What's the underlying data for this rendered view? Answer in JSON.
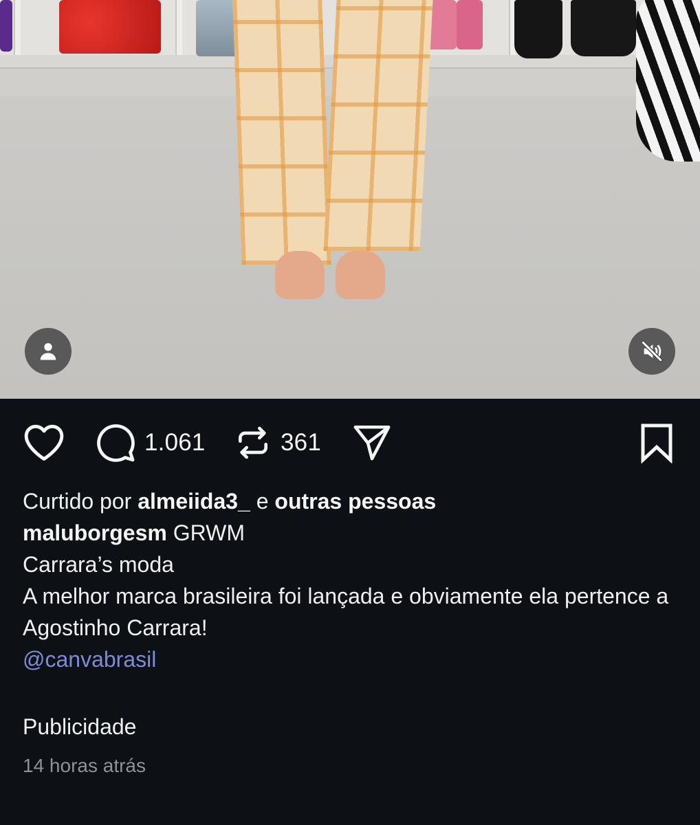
{
  "media": {
    "avatar_icon": "person-icon",
    "mute_icon": "speaker-muted-icon"
  },
  "actions": {
    "like_icon": "heart-icon",
    "comment_icon": "comment-bubble-icon",
    "comment_count": "1.061",
    "repost_icon": "repost-icon",
    "repost_count": "361",
    "share_icon": "send-icon",
    "save_icon": "bookmark-icon"
  },
  "post": {
    "liked_prefix": "Curtido por",
    "liked_user": "almeiida3_",
    "liked_conj": "e",
    "liked_others": "outras pessoas",
    "author": "maluborgesm",
    "caption_line1": "GRWM",
    "caption_line2": "Carrara’s moda",
    "caption_line3": "A melhor marca brasileira foi lançada e obviamente ela pertence a Agostinho Carrara!",
    "mention": "@canvabrasil",
    "ad_label": "Publicidade",
    "timestamp": "14 horas atrás"
  },
  "colors": {
    "background": "#0d1014",
    "text": "#f5f5f5",
    "mention": "#7e8bd8",
    "muted_text": "#8e9299"
  }
}
